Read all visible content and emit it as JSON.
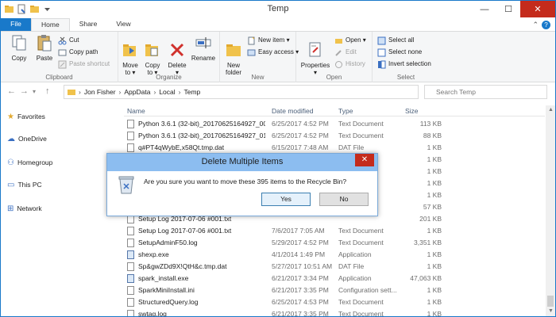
{
  "window": {
    "title": "Temp",
    "minimize": "—",
    "maximize": "☐",
    "close": "✕"
  },
  "tabs": {
    "file": "File",
    "home": "Home",
    "share": "Share",
    "view": "View",
    "collapse": "⌃",
    "help": "?"
  },
  "ribbon": {
    "clipboard": {
      "label": "Clipboard",
      "copy": "Copy",
      "paste": "Paste",
      "cut": "Cut",
      "copy_path": "Copy path",
      "paste_shortcut": "Paste shortcut"
    },
    "organize": {
      "label": "Organize",
      "move_to": "Move\nto ▾",
      "copy_to": "Copy\nto ▾",
      "delete": "Delete\n▾",
      "rename": "Rename"
    },
    "new": {
      "label": "New",
      "new_folder": "New\nfolder",
      "new_item": "New item ▾",
      "easy_access": "Easy access ▾"
    },
    "open": {
      "label": "Open",
      "properties": "Properties\n▾",
      "open": "Open ▾",
      "edit": "Edit",
      "history": "History"
    },
    "select": {
      "label": "Select",
      "select_all": "Select all",
      "select_none": "Select none",
      "invert": "Invert selection"
    }
  },
  "address": {
    "back": "←",
    "forward": "→",
    "recent": "▾",
    "up": "↑",
    "crumbs": [
      "Jon Fisher",
      "AppData",
      "Local",
      "Temp"
    ],
    "search_placeholder": "Search Temp"
  },
  "nav": {
    "favorites": "Favorites",
    "onedrive": "OneDrive",
    "homegroup": "Homegroup",
    "thispc": "This PC",
    "network": "Network"
  },
  "columns": {
    "name": "Name",
    "date": "Date modified",
    "type": "Type",
    "size": "Size"
  },
  "files": [
    {
      "name": "Python 3.6.1 (32-bit)_20170625164927_00...",
      "date": "6/25/2017 4:52 PM",
      "type": "Text Document",
      "size": "113 KB"
    },
    {
      "name": "Python 3.6.1 (32-bit)_20170625164927_01...",
      "date": "6/25/2017 4:52 PM",
      "type": "Text Document",
      "size": "88 KB"
    },
    {
      "name": "q#PT4qWybE,x58Qt.tmp.dat",
      "date": "6/15/2017 7:48 AM",
      "type": "DAT File",
      "size": "1 KB"
    },
    {
      "name": "",
      "date": "",
      "type": "",
      "size": "1 KB"
    },
    {
      "name": "",
      "date": "",
      "type": "",
      "size": "1 KB"
    },
    {
      "name": "",
      "date": "",
      "type": "",
      "size": "1 KB"
    },
    {
      "name": "",
      "date": "",
      "type": "",
      "size": "1 KB"
    },
    {
      "name": "",
      "date": "",
      "type": "",
      "size": "57 KB"
    },
    {
      "name": "Setup Log 2017-07-06 #001.txt",
      "date": "",
      "type": "",
      "size": "201 KB"
    },
    {
      "name": "Setup Log 2017-07-06 #001.txt",
      "date": "7/6/2017 7:05 AM",
      "type": "Text Document",
      "size": "1 KB"
    },
    {
      "name": "SetupAdminF50.log",
      "date": "5/29/2017 4:52 PM",
      "type": "Text Document",
      "size": "3,351 KB"
    },
    {
      "name": "shexp.exe",
      "date": "4/1/2014 1:49 PM",
      "type": "Application",
      "size": "1 KB"
    },
    {
      "name": "Sp&gwZDd9X!QtH&c.tmp.dat",
      "date": "5/27/2017 10:51 AM",
      "type": "DAT File",
      "size": "1 KB"
    },
    {
      "name": "spark_install.exe",
      "date": "6/21/2017 3:34 PM",
      "type": "Application",
      "size": "47,063 KB"
    },
    {
      "name": "SparkMiniInstall.ini",
      "date": "6/21/2017 3:35 PM",
      "type": "Configuration sett...",
      "size": "1 KB"
    },
    {
      "name": "StructuredQuery.log",
      "date": "6/25/2017 4:53 PM",
      "type": "Text Document",
      "size": "1 KB"
    },
    {
      "name": "swtag.log",
      "date": "6/21/2017 3:35 PM",
      "type": "Text Document",
      "size": "1 KB"
    }
  ],
  "dialog": {
    "title": "Delete Multiple Items",
    "close": "✕",
    "message": "Are you sure you want to move these 395 items to the Recycle Bin?",
    "yes": "Yes",
    "no": "No"
  }
}
